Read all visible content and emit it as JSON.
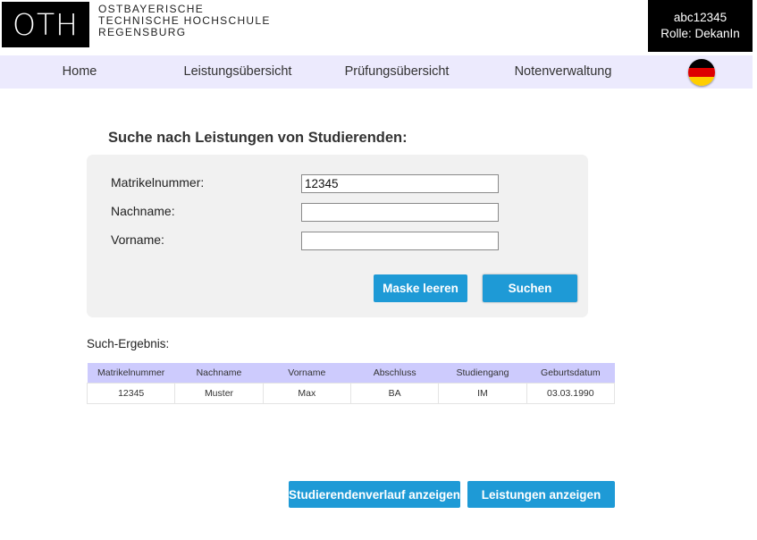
{
  "header": {
    "logo_text": "OTH",
    "university_lines": [
      "OSTBAYERISCHE",
      "TECHNISCHE HOCHSCHULE",
      "REGENSBURG"
    ],
    "user_id": "abc12345",
    "role": "Rolle: DekanIn"
  },
  "nav": {
    "items": [
      {
        "label": "Home"
      },
      {
        "label": "Leistungsübersicht"
      },
      {
        "label": "Prüfungsübersicht"
      },
      {
        "label": "Notenverwaltung"
      }
    ],
    "language_flag": "german-flag-icon"
  },
  "search": {
    "title": "Suche nach Leistungen von Studierenden:",
    "fields": [
      {
        "label": "Matrikelnummer:",
        "value": "12345"
      },
      {
        "label": "Nachname:",
        "value": ""
      },
      {
        "label": "Vorname:",
        "value": ""
      }
    ],
    "clear_label": "Maske leeren",
    "search_label": "Suchen"
  },
  "results": {
    "title": "Such-Ergebnis:",
    "columns": [
      "Matrikelnummer",
      "Nachname",
      "Vorname",
      "Abschluss",
      "Studiengang",
      "Geburtsdatum"
    ],
    "rows": [
      [
        "12345",
        "Muster",
        "Max",
        "BA",
        "IM",
        "03.03.1990"
      ]
    ]
  },
  "actions": {
    "history_label": "Studierendenverlauf anzeigen",
    "achievements_label": "Leistungen anzeigen"
  },
  "colors": {
    "accent": "#1e9ad6",
    "nav_bg": "#eceafd",
    "table_header_bg": "#cdcbfd",
    "panel_bg": "#f1f1f1"
  }
}
